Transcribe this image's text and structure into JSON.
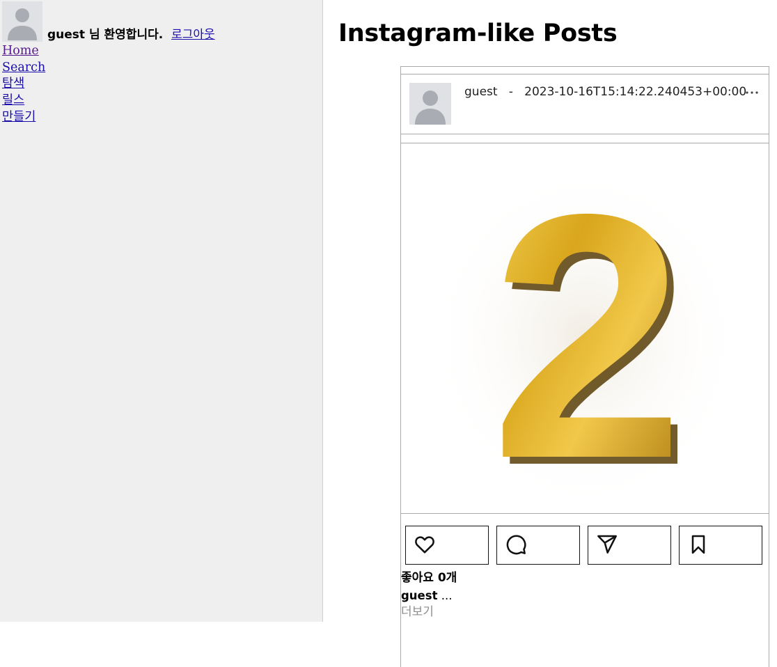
{
  "sidebar": {
    "username": "guest",
    "welcome_suffix": "님 환영합니다.",
    "logout_label": "로그아웃",
    "nav": [
      {
        "label": "Home"
      },
      {
        "label": "Search"
      },
      {
        "label": "탐색"
      },
      {
        "label": "릴스"
      },
      {
        "label": "만들기"
      }
    ]
  },
  "main": {
    "title": "Instagram-like Posts"
  },
  "post": {
    "author": "guest",
    "separator": "-",
    "timestamp": "2023-10-16T15:14:22.240453+00:00",
    "more_icon": "ellipsis-icon",
    "image_content": "2",
    "actions": [
      {
        "icon": "heart-icon"
      },
      {
        "icon": "comment-icon"
      },
      {
        "icon": "send-icon"
      },
      {
        "icon": "bookmark-icon"
      }
    ],
    "likes_label": "좋아요 0개",
    "caption_user": "guest",
    "caption_text": "...",
    "more_label": "더보기"
  },
  "colors": {
    "sidebar_bg": "#efefef",
    "link": "#1a0dab",
    "visited_link": "#551a8b",
    "muted_text": "#8e8e8e",
    "gold": "#d4a017"
  }
}
